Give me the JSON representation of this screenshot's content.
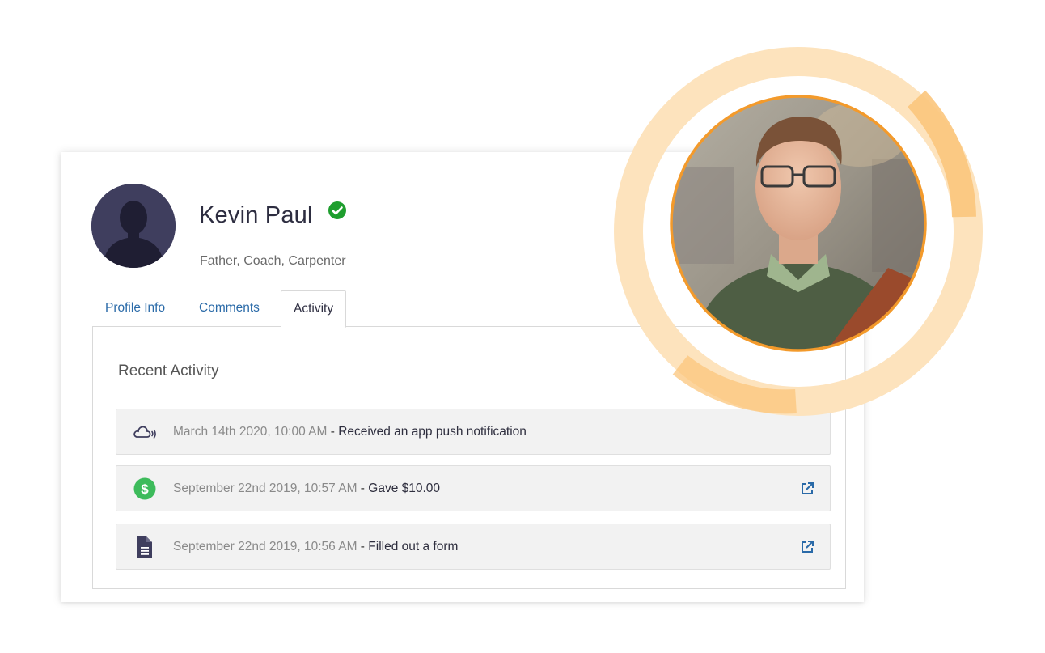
{
  "profile": {
    "name": "Kevin Paul",
    "subtitle": "Father, Coach, Carpenter",
    "verified_color": "#1e9e2e"
  },
  "tabs": [
    {
      "label": "Profile Info",
      "active": false
    },
    {
      "label": "Comments",
      "active": false
    },
    {
      "label": "Activity",
      "active": true
    }
  ],
  "activity": {
    "title": "Recent Activity",
    "items": [
      {
        "icon": "cloud-push-icon",
        "date": "March 14th 2020, 10:00 AM",
        "separator": " - ",
        "description": "Received an app push notification",
        "has_link": false
      },
      {
        "icon": "dollar-icon",
        "date": "September 22nd 2019, 10:57 AM",
        "separator": " - ",
        "description": "Gave $10.00",
        "has_link": true
      },
      {
        "icon": "document-icon",
        "date": "September 22nd 2019, 10:56 AM",
        "separator": " - ",
        "description": "Filled out a form",
        "has_link": true
      }
    ]
  },
  "colors": {
    "accent_orange": "#f39a2b",
    "ring_light": "#fde3bd",
    "link_blue": "#2a6aa8",
    "dollar_green": "#3dbb5b",
    "avatar_bg": "#3f3e5e"
  }
}
